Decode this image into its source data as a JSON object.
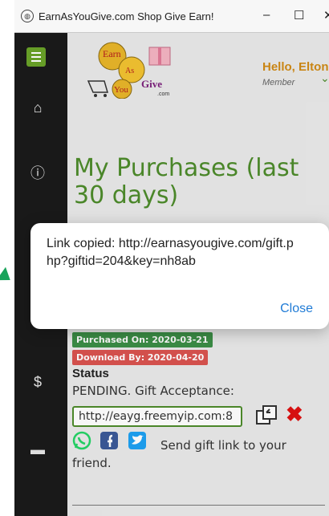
{
  "window": {
    "title": "EarnAsYouGive.com Shop Give Earn!",
    "controls": {
      "minimize": "–",
      "maximize": "☐",
      "close": "✕"
    }
  },
  "sidebar": {
    "icons": [
      "menu-icon",
      "home-icon",
      "info-icon",
      "dollar-icon",
      "folder-icon"
    ]
  },
  "header": {
    "logo_text": [
      "Earn",
      "As",
      "You",
      "Give",
      ".com"
    ],
    "greeting": "Hello, Elton",
    "role": "Member"
  },
  "page": {
    "title": "My Purchases (last 30 days)",
    "purchased_on": "Purchased On: 2020-03-21",
    "download_by": "Download By: 2020-04-20",
    "status_label": "Status",
    "status_text": "PENDING. Gift Acceptance:",
    "gift_link_value": "http://eayg.freemyip.com:8",
    "share_text": "Send gift link to your friend."
  },
  "dialog": {
    "message": "Link copied: http://earnasyougive.com/gift.php?giftid=204&key=nh8ab",
    "close_label": "Close"
  },
  "colors": {
    "accent_green": "#4d8b2b",
    "sidebar_bg": "#1a1a1a",
    "purchased_badge": "#3c8f47",
    "download_badge": "#d9534f",
    "greeting": "#d08a15",
    "dialog_link": "#1f7bd6"
  }
}
